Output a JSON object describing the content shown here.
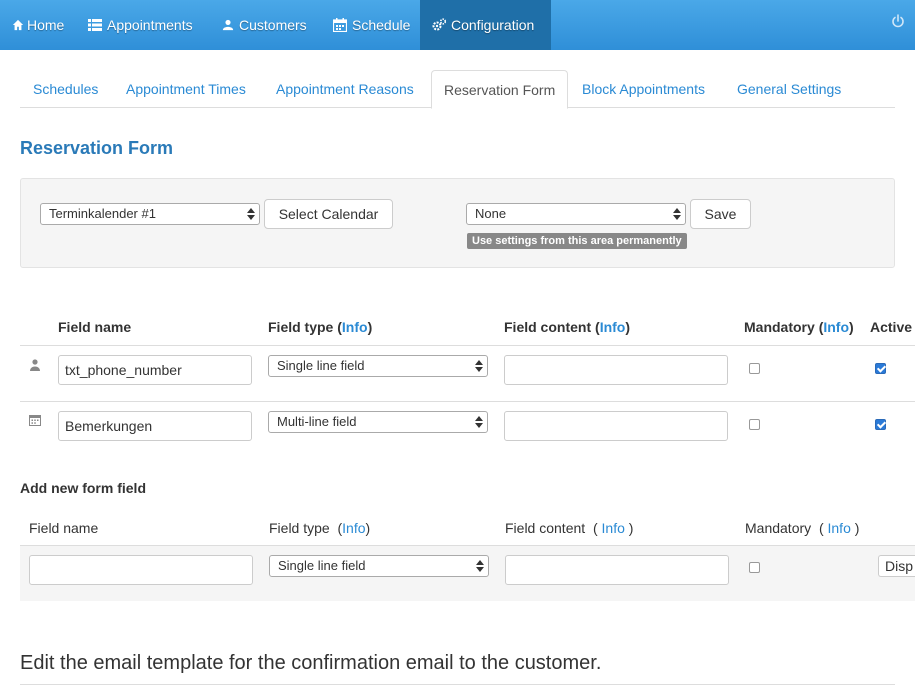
{
  "nav": {
    "items": [
      {
        "label": "Home",
        "icon": "home-icon"
      },
      {
        "label": "Appointments",
        "icon": "list-icon"
      },
      {
        "label": "Customers",
        "icon": "user-icon"
      },
      {
        "label": "Schedule",
        "icon": "calendar-icon"
      },
      {
        "label": "Configuration",
        "icon": "gears-icon",
        "active": true
      }
    ],
    "power_icon": "power-icon"
  },
  "tabs": [
    {
      "label": "Schedules"
    },
    {
      "label": "Appointment Times"
    },
    {
      "label": "Appointment Reasons"
    },
    {
      "label": "Reservation Form",
      "active": true
    },
    {
      "label": "Block Appointments"
    },
    {
      "label": "General Settings"
    }
  ],
  "page_title": "Reservation Form",
  "calendar_select": {
    "value": "Terminkalender #1",
    "button": "Select Calendar"
  },
  "area_select": {
    "value": "None",
    "button": "Save",
    "hint": "Use settings from this area permanently"
  },
  "fields_table": {
    "headers": {
      "name": "Field name",
      "type": "Field type",
      "content": "Field content",
      "mandatory": "Mandatory",
      "active": "Active",
      "info": "Info",
      "paren_open": "(",
      "paren_close": ")"
    },
    "rows": [
      {
        "icon": "user-icon",
        "name": "txt_phone_number",
        "type": "Single line field",
        "content": "",
        "mandatory": false,
        "active": true
      },
      {
        "icon": "calendar-icon",
        "name": "Bemerkungen",
        "type": "Multi-line field",
        "content": "",
        "mandatory": false,
        "active": true
      }
    ]
  },
  "add_field": {
    "title": "Add new form field",
    "headers": {
      "name": "Field name",
      "type": "Field type",
      "content": "Field content",
      "mandatory": "Mandatory",
      "info": "Info",
      "paren_open": "(",
      "paren_close": ")"
    },
    "name_value": "",
    "type_value": "Single line field",
    "content_value": "",
    "mandatory": false,
    "button": "Disp"
  },
  "email_section_title": "Edit the email template for the confirmation email to the customer.",
  "colors": {
    "navbar": "#2f8fd8",
    "nav_active": "#1f6fa8",
    "link": "#2a8ad4",
    "title": "#2a7ab8"
  }
}
